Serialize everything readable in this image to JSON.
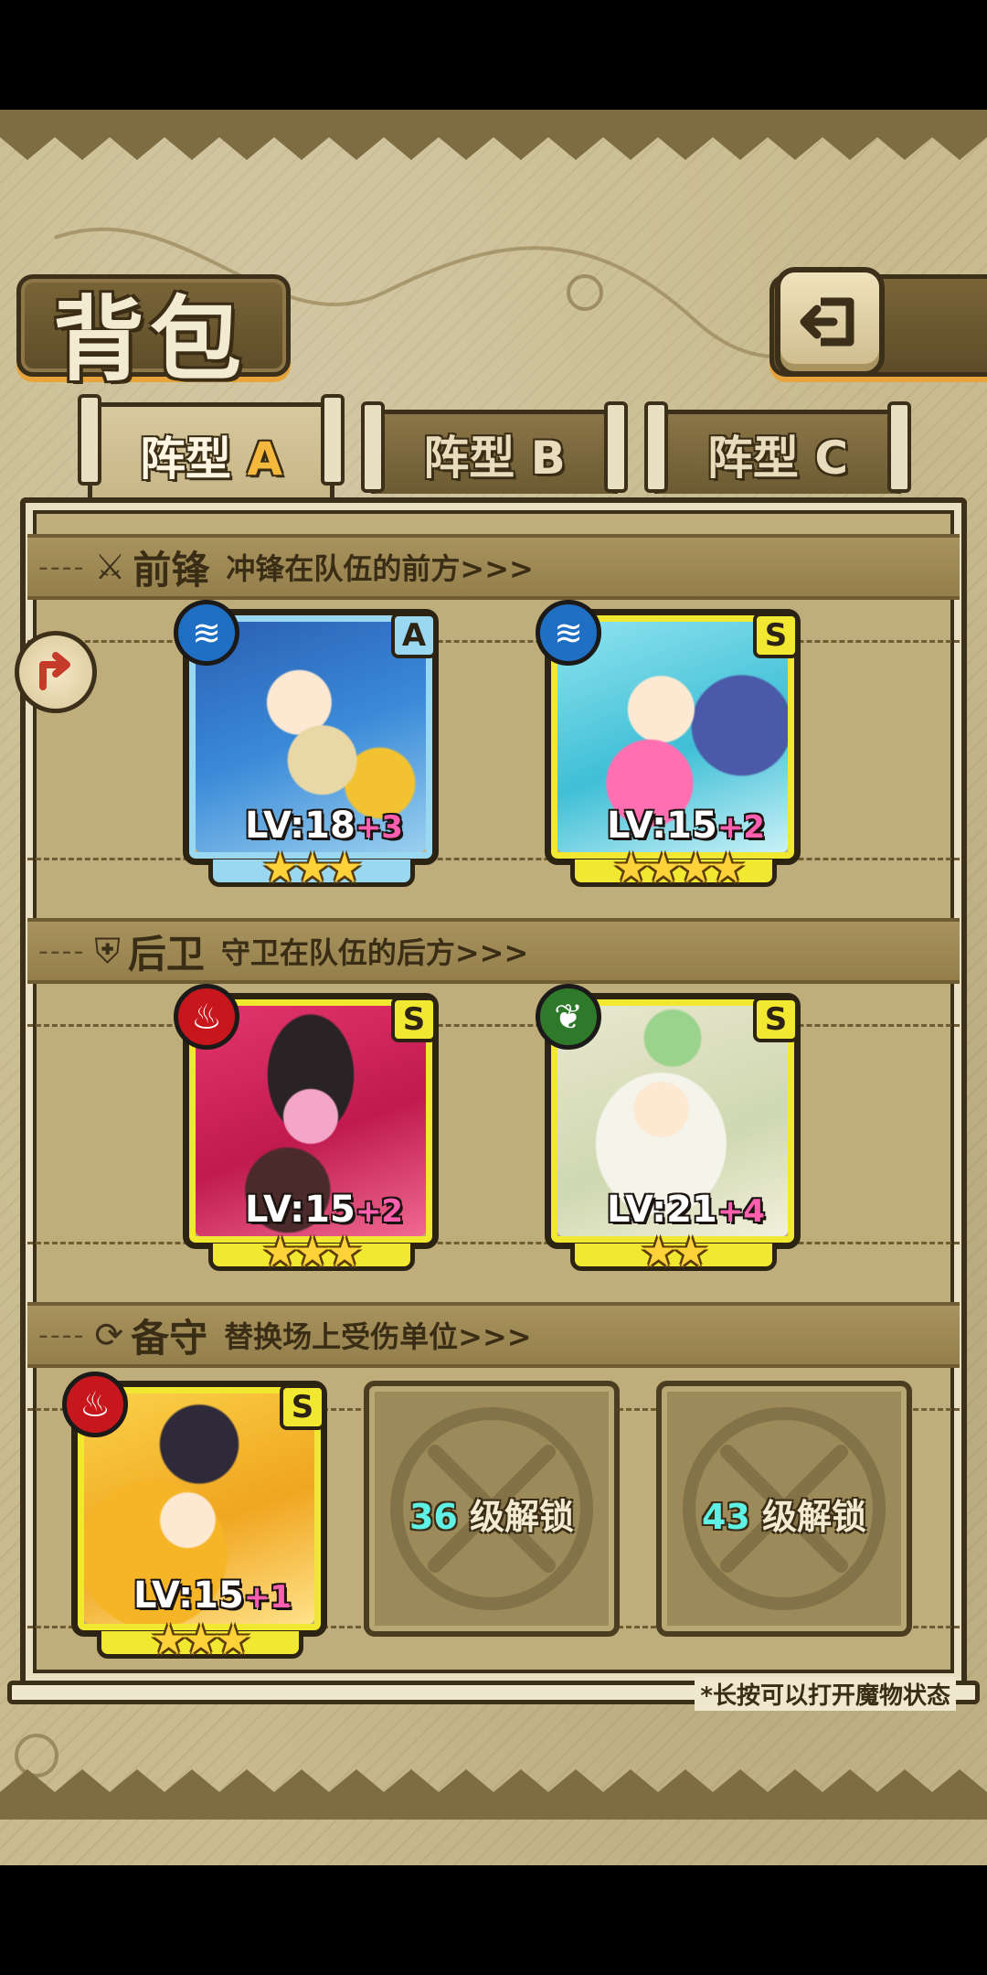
{
  "title": "背包",
  "tabs": [
    {
      "label": "阵型",
      "letter": "A",
      "active": true
    },
    {
      "label": "阵型",
      "letter": "B",
      "active": false
    },
    {
      "label": "阵型",
      "letter": "C",
      "active": false
    }
  ],
  "sections": {
    "front": {
      "title": "前锋",
      "subtitle": "冲锋在队伍的前方>>>",
      "icon": "sword-icon"
    },
    "back": {
      "title": "后卫",
      "subtitle": "守卫在队伍的后方>>>",
      "icon": "shield-icon"
    },
    "reserve": {
      "title": "备守",
      "subtitle": "替换场上受伤单位>>>",
      "icon": "swap-icon"
    }
  },
  "units": [
    {
      "id": "front1",
      "rank": "A",
      "element": "water",
      "lv": "LV:18",
      "plus": "+3",
      "stars": "★★★",
      "star_count": 3
    },
    {
      "id": "front2",
      "rank": "S",
      "element": "water",
      "lv": "LV:15",
      "plus": "+2",
      "stars": "★★★★",
      "star_count": 4
    },
    {
      "id": "back1",
      "rank": "S",
      "element": "fire",
      "lv": "LV:15",
      "plus": "+2",
      "stars": "★★★",
      "star_count": 3
    },
    {
      "id": "back2",
      "rank": "S",
      "element": "leaf",
      "lv": "LV:21",
      "plus": "+4",
      "stars": "★★",
      "star_count": 2
    },
    {
      "id": "reserve1",
      "rank": "S",
      "element": "fire",
      "lv": "LV:15",
      "plus": "+1",
      "stars": "★★★",
      "star_count": 3
    }
  ],
  "locked": [
    {
      "level": "36",
      "text": " 级解锁"
    },
    {
      "level": "43",
      "text": " 级解锁"
    }
  ],
  "footnote": "*长按可以打开魔物状态",
  "colors": {
    "rank_s": "#f2e832",
    "rank_a": "#9ad8f2",
    "water": "#1f6fc4",
    "fire": "#c8161d",
    "leaf": "#2f7a2a",
    "accent": "#f3b83c"
  }
}
